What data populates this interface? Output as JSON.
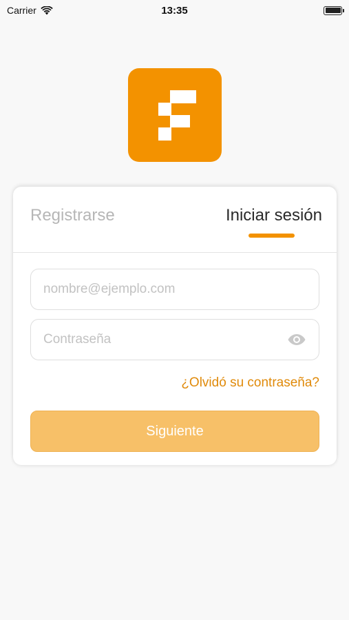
{
  "status_bar": {
    "carrier": "Carrier",
    "time": "13:35",
    "wifi_icon": "wifi-icon",
    "battery_icon": "battery-icon"
  },
  "logo": {
    "icon": "app-logo-icon",
    "background_color": "#f39200"
  },
  "tabs": {
    "register_label": "Registrarse",
    "login_label": "Iniciar sesión",
    "active": "login"
  },
  "form": {
    "email_placeholder": "nombre@ejemplo.com",
    "email_value": "",
    "password_placeholder": "Contraseña",
    "password_value": "",
    "show_password_icon": "eye-icon",
    "forgot_password_label": "¿Olvidó su contraseña?",
    "submit_label": "Siguiente"
  },
  "colors": {
    "accent": "#f39200",
    "link": "#e08a0a",
    "button_disabled": "#f7c068",
    "inactive_tab": "#b6b6b6"
  }
}
